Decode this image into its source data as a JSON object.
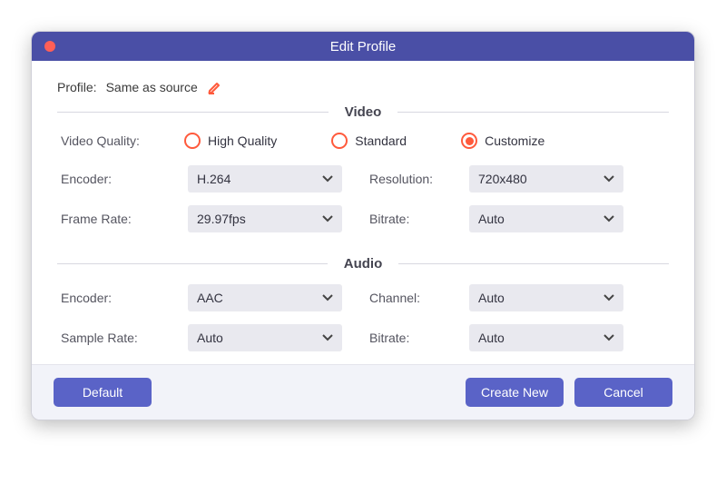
{
  "window": {
    "title": "Edit Profile"
  },
  "profile": {
    "label": "Profile:",
    "value": "Same as source"
  },
  "sections": {
    "video": "Video",
    "audio": "Audio"
  },
  "video": {
    "quality_label": "Video Quality:",
    "quality_options": {
      "high": "High Quality",
      "standard": "Standard",
      "customize": "Customize"
    },
    "quality_selected": "customize",
    "encoder_label": "Encoder:",
    "encoder_value": "H.264",
    "framerate_label": "Frame Rate:",
    "framerate_value": "29.97fps",
    "resolution_label": "Resolution:",
    "resolution_value": "720x480",
    "bitrate_label": "Bitrate:",
    "bitrate_value": "Auto"
  },
  "audio": {
    "encoder_label": "Encoder:",
    "encoder_value": "AAC",
    "samplerate_label": "Sample Rate:",
    "samplerate_value": "Auto",
    "channel_label": "Channel:",
    "channel_value": "Auto",
    "bitrate_label": "Bitrate:",
    "bitrate_value": "Auto"
  },
  "buttons": {
    "default": "Default",
    "create_new": "Create New",
    "cancel": "Cancel"
  },
  "colors": {
    "titlebar": "#4a4fa6",
    "accent_radio": "#ff5a3c",
    "button": "#5a63c7"
  }
}
